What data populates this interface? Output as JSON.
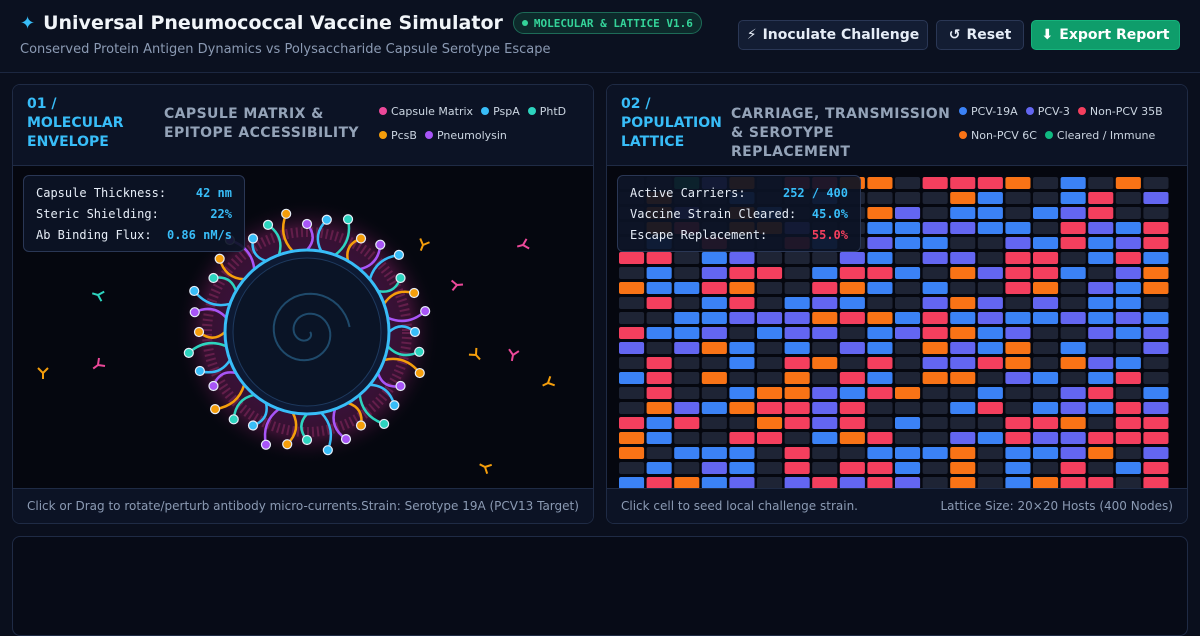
{
  "header": {
    "title": "Universal Pneumococcal Vaccine Simulator",
    "version_badge": "MOLECULAR & LATTICE V1.6",
    "subtitle": "Conserved Protein Antigen Dynamics vs Polysaccharide Capsule Serotype Escape",
    "buttons": {
      "inoculate_icon": "⚡",
      "inoculate_label": "Inoculate Challenge",
      "reset_icon": "↺",
      "reset_label": "Reset",
      "export_icon": "⬇",
      "export_label": "Export Report"
    }
  },
  "colors": {
    "capsule_matrix": "#ec4899",
    "pspa": "#38bdf8",
    "phtd": "#2dd4bf",
    "pcsb": "#f59e0b",
    "pneumolysin": "#a855f7",
    "pcv_19a": "#3b82f6",
    "pcv_3": "#6366f1",
    "non_pcv_35b": "#f43f5e",
    "non_pcv_6c": "#f97316",
    "cleared": "#10b981",
    "empty": "#1e2435"
  },
  "molecular_panel": {
    "number": "01 / MOLECULAR ENVELOPE",
    "title": "CAPSULE MATRIX & EPITOPE ACCESSIBILITY",
    "legend": [
      {
        "label": "Capsule Matrix",
        "color": "#ec4899"
      },
      {
        "label": "PspA",
        "color": "#38bdf8"
      },
      {
        "label": "PhtD",
        "color": "#2dd4bf"
      },
      {
        "label": "PcsB",
        "color": "#f59e0b"
      },
      {
        "label": "Pneumolysin",
        "color": "#a855f7"
      }
    ],
    "stats": [
      {
        "label": "Capsule Thickness:",
        "value": "42 nm"
      },
      {
        "label": "Steric Shielding:",
        "value": "22%"
      },
      {
        "label": "Ab Binding Flux:",
        "value": "0.86 nM/s"
      }
    ],
    "footer_left": "Click or Drag to rotate/perturb antibody micro-currents.",
    "footer_right": "Strain: Serotype 19A (PCV13 Target)",
    "antibody_colors": [
      "#f59e0b",
      "#ec4899",
      "#2dd4bf",
      "#38bdf8",
      "#f59e0b",
      "#ec4899",
      "#f59e0b",
      "#ec4899",
      "#f59e0b",
      "#f59e0b",
      "#2dd4bf",
      "#f59e0b",
      "#38bdf8",
      "#2dd4bf",
      "#f59e0b",
      "#ec4899"
    ]
  },
  "lattice_panel": {
    "number": "02 / POPULATION LATTICE",
    "title": "CARRIAGE, TRANSMISSION & SEROTYPE REPLACEMENT",
    "legend": [
      {
        "label": "PCV-19A",
        "color": "#3b82f6"
      },
      {
        "label": "PCV-3",
        "color": "#6366f1"
      },
      {
        "label": "Non-PCV 35B",
        "color": "#f43f5e"
      },
      {
        "label": "Non-PCV 6C",
        "color": "#f97316"
      },
      {
        "label": "Cleared / Immune",
        "color": "#10b981"
      }
    ],
    "stats": [
      {
        "label": "Active Carriers:",
        "value": "252 / 400",
        "color": "#38bdf8"
      },
      {
        "label": "Vaccine Strain Cleared:",
        "value": "45.0%",
        "color": "#38bdf8"
      },
      {
        "label": "Escape Replacement:",
        "value": "55.0%",
        "color": "#f43f5e"
      }
    ],
    "footer_left": "Click cell to seed local challenge strain.",
    "footer_right": "Lattice Size: 20×20 Hosts (400 Nodes)",
    "grid": [
      "__EQO_NNOO_NNNO_B_O_",
      "_O__B__B____OB__BN_Q",
      "_OQ_OB___OQ_BB_BQN__",
      "_ON_OOQ__BBQQBB_NQBN",
      "_B_N__NB_QBB__QBNBQN",
      "NN_BQ___QB_QQ_NN_BNB",
      "_B_QNN_BNNB_OQNNB_QO",
      "OBBNO__NOB_B__NO_QBO",
      "_N_BN_BQB__QOQ_Q_BB_",
      "__BBQQQONOBNBQBBQBQB",
      "NBBQ_BQQ_BQNOBQ__QBQ",
      "Q_QOB_B_QB_OQBO_B__Q",
      "_N__B_NO_N_QQNO_OQB_",
      "BN_O__O_NB_OO_QB_BN_",
      "_N__BOOQBNO__B__QN_B",
      "_OQBONNQN___BN_BQBNQ",
      "NBN__ONQN_B___NNO_NN",
      "OB__NN_BON__QBNQQNNN",
      "O_BBB_N__BBBO_BBQO_Q",
      "_B_QB_N_NNB_O_B_N_BN",
      "BNOBQ_QNQNQ_O_BONN_N"
    ]
  }
}
